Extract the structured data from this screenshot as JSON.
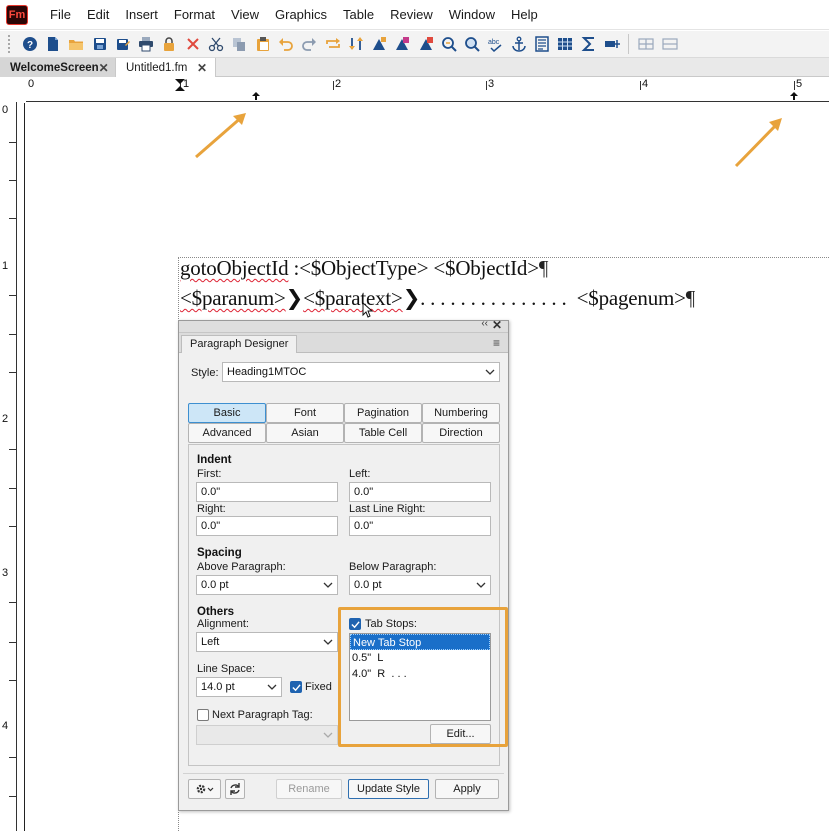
{
  "app": {
    "logo_text": "Fm",
    "menu": [
      "File",
      "Edit",
      "Insert",
      "Format",
      "View",
      "Graphics",
      "Table",
      "Review",
      "Window",
      "Help"
    ]
  },
  "toolbar": {
    "icons": [
      "help-icon",
      "new-document-icon",
      "open-folder-icon",
      "save-icon",
      "save-as-icon",
      "print-icon",
      "lock-icon",
      "delete-icon",
      "cut-icon",
      "copy-icon",
      "paste-icon",
      "undo-icon",
      "redo-icon",
      "repeat-icon",
      "swap-icon",
      "insert-marker-icon",
      "insert-xref-icon",
      "insert-variable-icon",
      "find-icon",
      "zoom-icon",
      "spellcheck-icon",
      "anchor-icon",
      "text-frame-icon",
      "table-icon",
      "equation-icon",
      "insert-field-icon",
      "layout-grid-icon",
      "layout-grid-2-icon"
    ]
  },
  "tabs": [
    {
      "label": "WelcomeScreen",
      "close": "✕"
    },
    {
      "label": "Untitled1.fm",
      "close": "✕"
    }
  ],
  "ruler": {
    "h_numbers": [
      "0",
      "1",
      "2",
      "3",
      "4",
      "5"
    ],
    "v_numbers": [
      "0",
      "1",
      "2",
      "3",
      "4"
    ]
  },
  "document": {
    "line1": {
      "a": "gotoObjectId",
      "b": " :<$ObjectType> <$ObjectId>",
      "pilcrow": "¶"
    },
    "line2": {
      "a": "<$paranum>",
      "b": "❯",
      "c": "<$paratext>",
      "d": "❯. . . . . . . . . . . . . . .  <$pagenum>",
      "pilcrow": "¶"
    }
  },
  "designer": {
    "title": "Paragraph Designer",
    "collapse": "‹‹",
    "close": "✕",
    "menu_icon": "≡",
    "style_label": "Style:",
    "style_value": "Heading1MTOC",
    "tabs": [
      "Basic",
      "Font",
      "Pagination",
      "Numbering",
      "Advanced",
      "Asian",
      "Table Cell",
      "Direction"
    ],
    "selected_tab": "Basic",
    "indent": {
      "heading": "Indent",
      "first_label": "First:",
      "first_value": "0.0\"",
      "left_label": "Left:",
      "left_value": "0.0\"",
      "right_label": "Right:",
      "right_value": "0.0\"",
      "last_line_right_label": "Last Line Right:",
      "last_line_right_value": "0.0\""
    },
    "spacing": {
      "heading": "Spacing",
      "above_label": "Above Paragraph:",
      "above_value": "0.0 pt",
      "below_label": "Below Paragraph:",
      "below_value": "0.0 pt"
    },
    "others": {
      "heading": "Others",
      "alignment_label": "Alignment:",
      "alignment_value": "Left",
      "line_space_label": "Line Space:",
      "line_space_value": "14.0 pt",
      "fixed_label": "Fixed",
      "fixed_checked": true,
      "next_tag_label": "Next Paragraph Tag:",
      "next_tag_checked": false
    },
    "tab_stops": {
      "label": "Tab Stops:",
      "checked": true,
      "items": [
        "New Tab Stop",
        "0.5\"  L",
        "4.0\"  R  . . ."
      ],
      "selected_index": 0,
      "edit_label": "Edit..."
    },
    "footer": {
      "rename_label": "Rename",
      "update_label": "Update Style",
      "apply_label": "Apply"
    }
  },
  "colors": {
    "accent_blue": "#1a6fc9",
    "highlight_orange": "#e8a33c",
    "logo_red": "#ff4a3d"
  }
}
